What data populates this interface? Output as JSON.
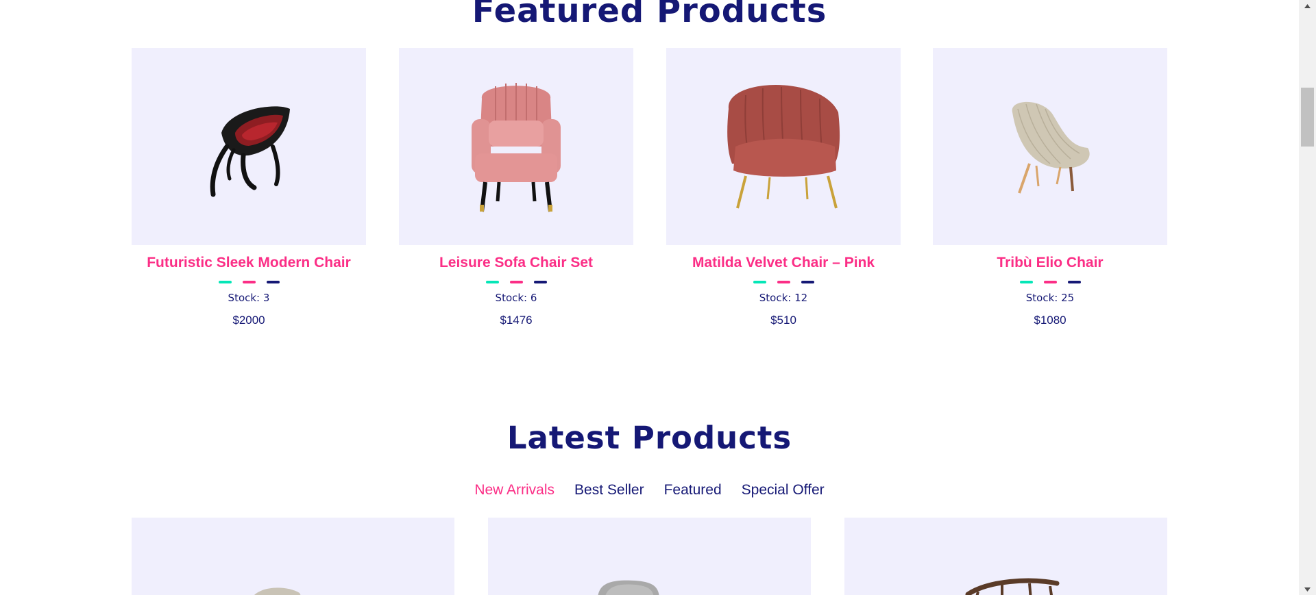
{
  "featured": {
    "title": "Featured Products",
    "products": [
      {
        "name": "Futuristic Sleek Modern Chair",
        "stock": "Stock: 3",
        "price": "$2000",
        "image": "black-red-sculptural-chair"
      },
      {
        "name": "Leisure Sofa Chair Set",
        "stock": "Stock: 6",
        "price": "$1476",
        "image": "pink-wingback-armchair"
      },
      {
        "name": "Matilda Velvet Chair – Pink",
        "stock": "Stock: 12",
        "price": "$510",
        "image": "terracotta-shell-velvet-chair"
      },
      {
        "name": "Tribù Elio Chair",
        "stock": "Stock: 25",
        "price": "$1080",
        "image": "beige-woven-lounge-chair"
      }
    ],
    "dot_colors": [
      "#05E6B7",
      "#FB2E86",
      "#151875"
    ]
  },
  "latest": {
    "title": "Latest Products",
    "tabs": [
      {
        "label": "New Arrivals",
        "active": true
      },
      {
        "label": "Best Seller",
        "active": false
      },
      {
        "label": "Featured",
        "active": false
      },
      {
        "label": "Special Offer",
        "active": false
      }
    ],
    "cards": [
      {
        "image": "beige-chair-top"
      },
      {
        "image": "grey-chair-top"
      },
      {
        "image": "wooden-chair-top"
      }
    ]
  },
  "colors": {
    "heading": "#151875",
    "accent": "#FB2E86",
    "card_bg": "#F0EFFD"
  }
}
